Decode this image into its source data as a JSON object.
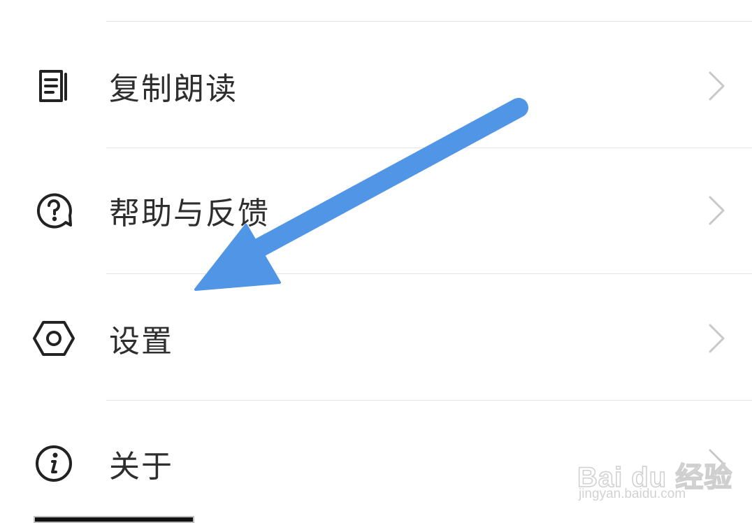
{
  "menu": {
    "items": [
      {
        "label": "复制朗读",
        "icon": "document-lines-icon"
      },
      {
        "label": "帮助与反馈",
        "icon": "question-bubble-icon"
      },
      {
        "label": "设置",
        "icon": "hexagon-gear-icon"
      },
      {
        "label": "关于",
        "icon": "info-circle-icon"
      }
    ],
    "chevron_icon": "chevron-right-icon"
  },
  "annotation": {
    "arrow_color": "#5195e6",
    "points_to": "设置"
  },
  "watermark": {
    "logo": "Bai du 经验",
    "url": "jingyan.baidu.com"
  },
  "colors": {
    "background": "#ffffff",
    "text": "#2e2e2e",
    "divider": "#e3e3e3",
    "chevron": "#c8c8c8"
  }
}
